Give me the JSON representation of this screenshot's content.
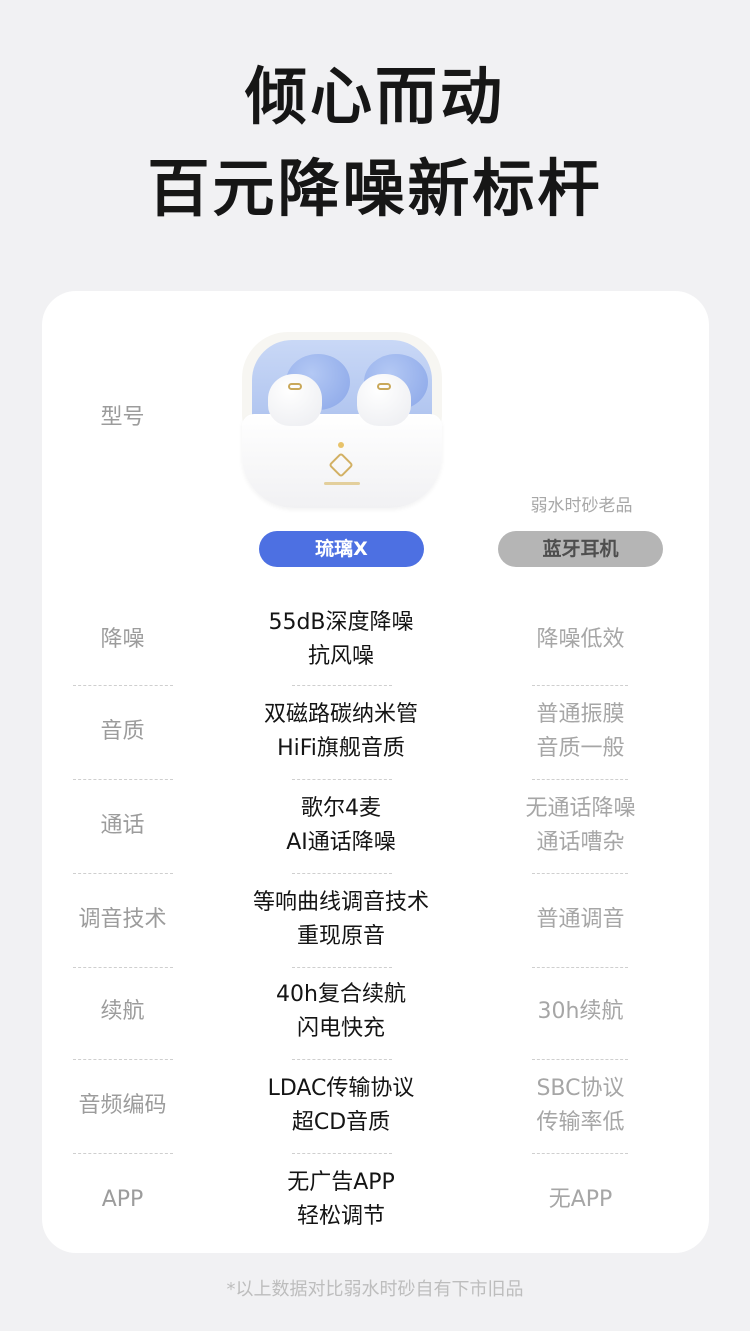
{
  "headline": {
    "line1": "倾心而动",
    "line2": "百元降噪新标杆"
  },
  "columns": {
    "model_label": "型号",
    "new_product": "琉璃X",
    "old_caption": "弱水时砂老品",
    "old_product": "蓝牙耳机"
  },
  "rows": [
    {
      "label": "降噪",
      "new": [
        "55dB深度降噪",
        "抗风噪"
      ],
      "old": [
        "降噪低效"
      ]
    },
    {
      "label": "音质",
      "new": [
        "双磁路碳纳米管",
        "HiFi旗舰音质"
      ],
      "old": [
        "普通振膜",
        "音质一般"
      ]
    },
    {
      "label": "通话",
      "new": [
        "歌尔4麦",
        "AI通话降噪"
      ],
      "old": [
        "无通话降噪",
        "通话嘈杂"
      ]
    },
    {
      "label": "调音技术",
      "new": [
        "等响曲线调音技术",
        "重现原音"
      ],
      "old": [
        "普通调音"
      ]
    },
    {
      "label": "续航",
      "new": [
        "40h复合续航",
        "闪电快充"
      ],
      "old": [
        "30h续航"
      ]
    },
    {
      "label": "音频编码",
      "new": [
        "LDAC传输协议",
        "超CD音质"
      ],
      "old": [
        "SBC协议",
        "传输率低"
      ]
    },
    {
      "label": "APP",
      "new": [
        "无广告APP",
        "轻松调节"
      ],
      "old": [
        "无APP"
      ]
    }
  ],
  "footnote": "*以上数据对比弱水时砂自有下市旧品",
  "colors": {
    "accent": "#4d70e2",
    "old_pill": "#b5b5b5",
    "background": "#f1f1f3"
  }
}
